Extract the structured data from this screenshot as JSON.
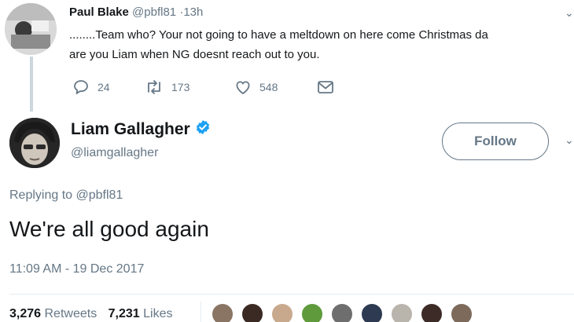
{
  "parent_tweet": {
    "name": "Paul Blake",
    "handle": "@pbfl81",
    "time": "·13h",
    "text_line1": "........Team who?  Your not going to have a meltdown on here come Christmas da",
    "text_line2": "are you Liam when NG doesnt reach out to you.",
    "reply_count": "24",
    "retweet_count": "173",
    "like_count": "548",
    "icons": [
      "reply-icon",
      "retweet-icon",
      "heart-icon",
      "message-icon",
      "chevron-down-icon"
    ]
  },
  "tweet": {
    "name": "Liam Gallagher",
    "verified": true,
    "handle": "@liamgallagher",
    "follow_label": "Follow",
    "replying_prefix": "Replying to ",
    "replying_handle": "@pbfl81",
    "text": "We're all good again",
    "timestamp": "11:09 AM - 19 Dec 2017",
    "retweets_count": "3,276",
    "retweets_label": "Retweets",
    "likes_count": "7,231",
    "likes_label": "Likes"
  },
  "colors": {
    "accent": "#1da1f2",
    "muted": "#657786",
    "text": "#14171a",
    "divider": "#e6ecf0"
  }
}
